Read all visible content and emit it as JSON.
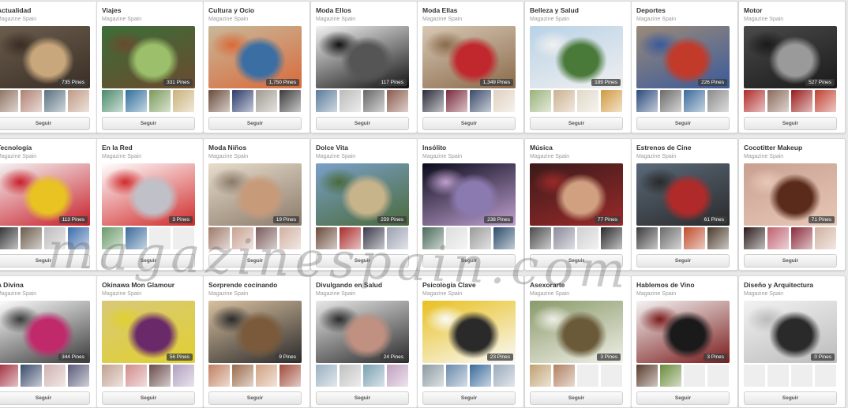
{
  "follow_label": "Seguir",
  "owner": "Magazine Spain",
  "watermark": "magazinespain.com",
  "boards": [
    {
      "title": "Actualidad",
      "pins": "735 Pines",
      "cover_colors": [
        "#6b5e4e",
        "#c9a77c",
        "#3a2e25"
      ],
      "thumb_colors": [
        "#8a6d5a",
        "#b08070",
        "#5a7080",
        "#c09a84"
      ]
    },
    {
      "title": "Viajes",
      "pins": "331 Pines",
      "cover_colors": [
        "#3c6e3a",
        "#9bbf6a",
        "#6b4a2e"
      ],
      "thumb_colors": [
        "#4a8a6a",
        "#2f6f9a",
        "#7a9a5a",
        "#c9b27a"
      ]
    },
    {
      "title": "Cultura y Ocio",
      "pins": "1,750 Pines",
      "cover_colors": [
        "#c8b89a",
        "#3b6fa3",
        "#d96a3a"
      ],
      "thumb_colors": [
        "#6a4a3a",
        "#2a3a6a",
        "#a09a90",
        "#3a3a3a"
      ]
    },
    {
      "title": "Moda Ellos",
      "pins": "117 Pines",
      "cover_colors": [
        "#f2f2f2",
        "#555555",
        "#111111"
      ],
      "thumb_colors": [
        "#5a7a9a",
        "#bbbbbb",
        "#666666",
        "#8a5a4a"
      ]
    },
    {
      "title": "Moda Ellas",
      "pins": "1,349 Pines",
      "cover_colors": [
        "#d7c8b5",
        "#c0282d",
        "#8a6a4a"
      ],
      "thumb_colors": [
        "#2a2a3a",
        "#7a2a3a",
        "#3a4a6a",
        "#e0d0c0"
      ]
    },
    {
      "title": "Belleza y Salud",
      "pins": "189 Pines",
      "cover_colors": [
        "#b9d2e6",
        "#4a7a3a",
        "#f0f0f0"
      ],
      "thumb_colors": [
        "#9ab27a",
        "#ccb090",
        "#e0d8c8",
        "#d09a40"
      ]
    },
    {
      "title": "Deportes",
      "pins": "226 Pines",
      "cover_colors": [
        "#9a8a7a",
        "#c23a2a",
        "#3a5a9a"
      ],
      "thumb_colors": [
        "#2a4a7a",
        "#6a6a6a",
        "#3a6a9a",
        "#8a8a8a"
      ]
    },
    {
      "title": "Motor",
      "pins": "527 Pines",
      "cover_colors": [
        "#4a4a4a",
        "#9a9a9a",
        "#1a1a1a"
      ],
      "thumb_colors": [
        "#b02a2a",
        "#8a6a5a",
        "#9a1a1a",
        "#c04030"
      ]
    },
    {
      "title": "Tecnología",
      "pins": "113 Pines",
      "cover_colors": [
        "#f4f4f4",
        "#e8c321",
        "#c81f2a"
      ],
      "thumb_colors": [
        "#2a2a2a",
        "#6a5a4a",
        "#bbbbbb",
        "#3a6aaa"
      ]
    },
    {
      "title": "En la Red",
      "pins": "3 Pines",
      "cover_colors": [
        "#ffffff",
        "#c0c0c8",
        "#d02a2a"
      ],
      "thumb_colors": [
        "#6a9a6a",
        "#3a6a9a",
        "#eeeeee",
        "#eeeeee"
      ]
    },
    {
      "title": "Moda Niños",
      "pins": "19 Pines",
      "cover_colors": [
        "#e8dccb",
        "#c79a7a",
        "#8a7a6a"
      ],
      "thumb_colors": [
        "#a07a6a",
        "#c8a090",
        "#7a5a5a",
        "#d0b0a0"
      ]
    },
    {
      "title": "Dolce Vita",
      "pins": "259 Pines",
      "cover_colors": [
        "#7aa0c8",
        "#c8b48a",
        "#4a6a3a"
      ],
      "thumb_colors": [
        "#6a4a3a",
        "#aa2a2a",
        "#3a3a4a",
        "#9aa0b0"
      ]
    },
    {
      "title": "Insólito",
      "pins": "238 Pines",
      "cover_colors": [
        "#0a0a1a",
        "#8a7ab0",
        "#c0a0d0"
      ],
      "thumb_colors": [
        "#4a6a5a",
        "#dddddd",
        "#9a9a9a",
        "#2a4a6a"
      ]
    },
    {
      "title": "Música",
      "pins": "77 Pines",
      "cover_colors": [
        "#3a1a1a",
        "#d0a080",
        "#9a2a2a"
      ],
      "thumb_colors": [
        "#4a4a4a",
        "#8a8a9a",
        "#d0d0d0",
        "#2a2a2a"
      ]
    },
    {
      "title": "Estrenos de Cine",
      "pins": "61 Pines",
      "cover_colors": [
        "#5a6a7a",
        "#b02a2a",
        "#2a2a2a"
      ],
      "thumb_colors": [
        "#3a3a3a",
        "#6a6a6a",
        "#c04a2a",
        "#4a3a2a"
      ]
    },
    {
      "title": "Cocotitter Makeup",
      "pins": "71 Pines",
      "cover_colors": [
        "#c8a090",
        "#5a2a1a",
        "#e8c8b8"
      ],
      "thumb_colors": [
        "#2a1a1a",
        "#c06070",
        "#8a2a3a",
        "#d0b0a0"
      ]
    },
    {
      "title": "A Divina",
      "pins": "344 Pines",
      "cover_colors": [
        "#ffffff",
        "#c02a6a",
        "#3a3a3a"
      ],
      "thumb_colors": [
        "#a02a3a",
        "#3a4a6a",
        "#d0b0b0",
        "#5a5a7a"
      ]
    },
    {
      "title": "Okinawa Mon Glamour",
      "pins": "56 Pines",
      "cover_colors": [
        "#d8c878",
        "#6a2a6a",
        "#e0d030"
      ],
      "thumb_colors": [
        "#c0a090",
        "#d08a8a",
        "#6a4a4a",
        "#b0a0c0"
      ]
    },
    {
      "title": "Sorprende cocinando",
      "pins": "9 Pines",
      "cover_colors": [
        "#d8c0a0",
        "#7a5a3a",
        "#2a2a2a"
      ],
      "thumb_colors": [
        "#c08060",
        "#9a6a4a",
        "#d0a080",
        "#a04a3a"
      ]
    },
    {
      "title": "Divulgando en Salud",
      "pins": "24 Pines",
      "cover_colors": [
        "#e8e8e8",
        "#c09080",
        "#2a2a2a"
      ],
      "thumb_colors": [
        "#9ab0c0",
        "#c0c0c0",
        "#7aa0b0",
        "#c0a0c0"
      ]
    },
    {
      "title": "Psicología Clave",
      "pins": "23 Pines",
      "cover_colors": [
        "#e8c020",
        "#2a2a2a",
        "#fafafa"
      ],
      "thumb_colors": [
        "#8a9aa0",
        "#6a8aaa",
        "#3a6a9a",
        "#9aaabb"
      ]
    },
    {
      "title": "Asexorarte",
      "pins": "3 Pines",
      "cover_colors": [
        "#8a9a6a",
        "#6a5a3a",
        "#f0f0e8"
      ],
      "thumb_colors": [
        "#c0a070",
        "#b08060",
        "#eeeeee",
        "#eeeeee"
      ]
    },
    {
      "title": "Hablemos de Vino",
      "pins": "3 Pines",
      "cover_colors": [
        "#f4f4f4",
        "#1a1a1a",
        "#7a1a1a"
      ],
      "thumb_colors": [
        "#5a3a2a",
        "#6a8a3a",
        "#eeeeee",
        "#eeeeee"
      ]
    },
    {
      "title": "Diseño y Arquitectura",
      "pins": "0 Pines",
      "cover_colors": [
        "#f2f2f2",
        "#2a2a2a",
        "#bbbbbb"
      ],
      "thumb_colors": [
        "#eeeeee",
        "#eeeeee",
        "#eeeeee",
        "#eeeeee"
      ]
    }
  ]
}
